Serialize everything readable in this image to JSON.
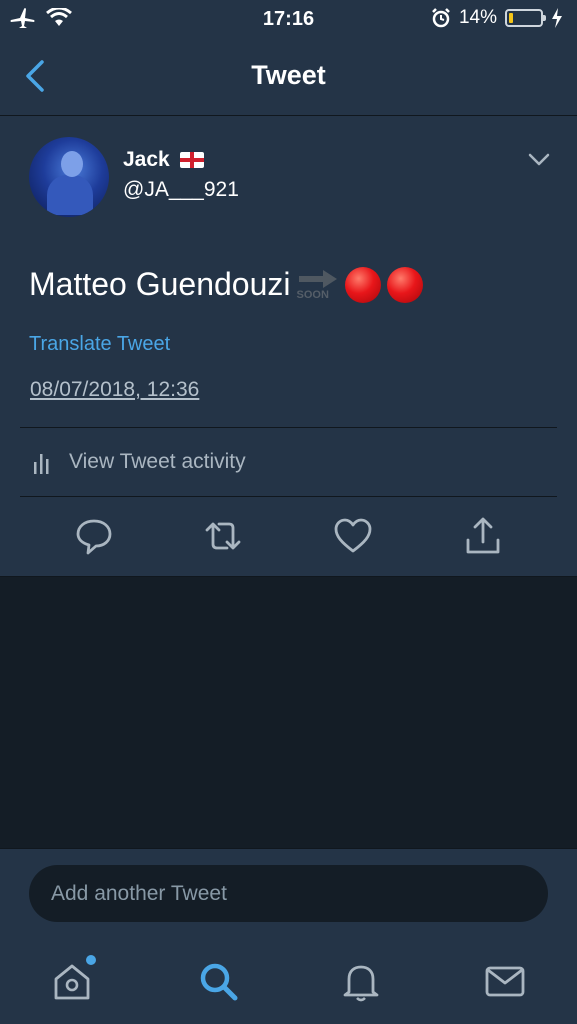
{
  "status_bar": {
    "time": "17:16",
    "battery": "14%",
    "battery_level": 0.14
  },
  "nav": {
    "title": "Tweet"
  },
  "tweet": {
    "user_name": "Jack",
    "handle": "@JA___921",
    "text": "Matteo Guendouzi",
    "soon_label": "SOON",
    "translate_label": "Translate Tweet",
    "timestamp": "08/07/2018, 12:36",
    "activity_label": "View Tweet activity"
  },
  "compose": {
    "placeholder": "Add another Tweet"
  },
  "colors": {
    "background": "#141d26",
    "card": "#243447",
    "accent": "#4aa6e6"
  },
  "icons": {
    "status": [
      "airplane-icon",
      "wifi-icon",
      "alarm-icon",
      "battery-icon",
      "charging-icon"
    ],
    "actions": [
      "reply-icon",
      "retweet-icon",
      "like-icon",
      "share-icon"
    ],
    "tabs": [
      "home-icon",
      "search-icon",
      "notifications-icon",
      "messages-icon"
    ]
  }
}
